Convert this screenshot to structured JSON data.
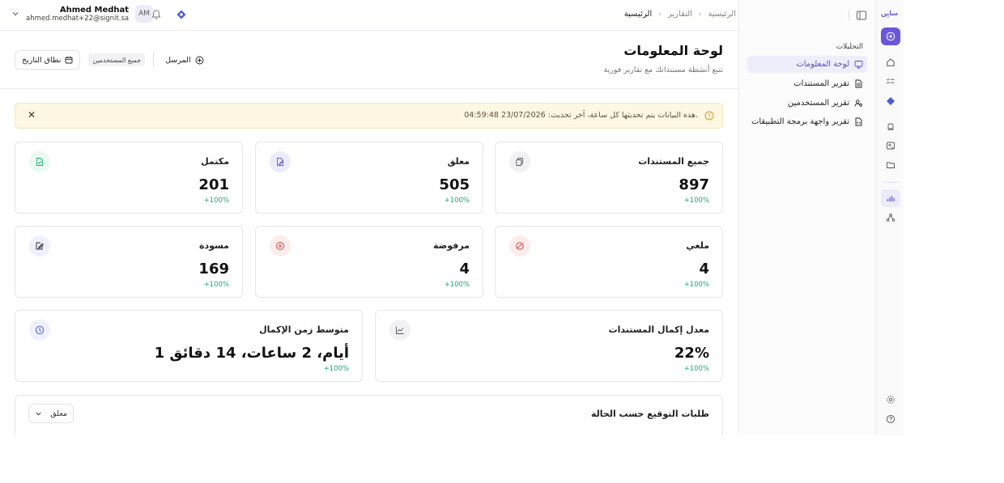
{
  "rail": {
    "logo": "سايِن"
  },
  "sidebar": {
    "section_title": "التحليلات",
    "items": [
      {
        "label": "لوحة المعلومات",
        "active": true
      },
      {
        "label": "تقرير المستندات"
      },
      {
        "label": "تقرير المستخدمين"
      },
      {
        "label": "تقرير واجهة برمجة التطبيقات"
      }
    ]
  },
  "topbar": {
    "breadcrumbs": [
      "الرئيسية",
      "التقارير",
      "الرئيسية"
    ],
    "user_name": "Ahmed Medhat",
    "user_email": "ahmed.medhat+22@signit.sa",
    "avatar_initials": "AM"
  },
  "header": {
    "title": "لوحة المعلومات",
    "subtitle": "تتبع أنشطة مستنداتك مع تقارير فورية",
    "sender_label": "المرسل",
    "all_users_tag": "جميع المستخدمين",
    "date_range_label": "نطاق التاريخ"
  },
  "banner": {
    "text": "هذه البيانات يتم تحديثها كل ساعة، آخر تحديث: 23/07/2026 04:59:48."
  },
  "stats": [
    {
      "title": "جميع المستندات",
      "value": "897",
      "delta": "+100%"
    },
    {
      "title": "معلق",
      "value": "505",
      "delta": "+100%"
    },
    {
      "title": "مكتمل",
      "value": "201",
      "delta": "+100%"
    },
    {
      "title": "ملغي",
      "value": "4",
      "delta": "+100%"
    },
    {
      "title": "مرفوضة",
      "value": "4",
      "delta": "+100%"
    },
    {
      "title": "مسودة",
      "value": "169",
      "delta": "+100%"
    },
    {
      "title": "معدل إكمال المستندات",
      "value": "22%",
      "delta": "+100%"
    },
    {
      "title": "متوسط زمن الإكمال",
      "value": "1 أيام، 2 ساعات، 14 دقائق",
      "delta": "+100%"
    }
  ],
  "status_section": {
    "title": "طلبات التوقيع حسب الحالة",
    "filter_value": "معلق"
  },
  "colors": {
    "accent": "#6b55d9",
    "positive": "#1aa876",
    "banner_bg": "#fdf7e3"
  }
}
